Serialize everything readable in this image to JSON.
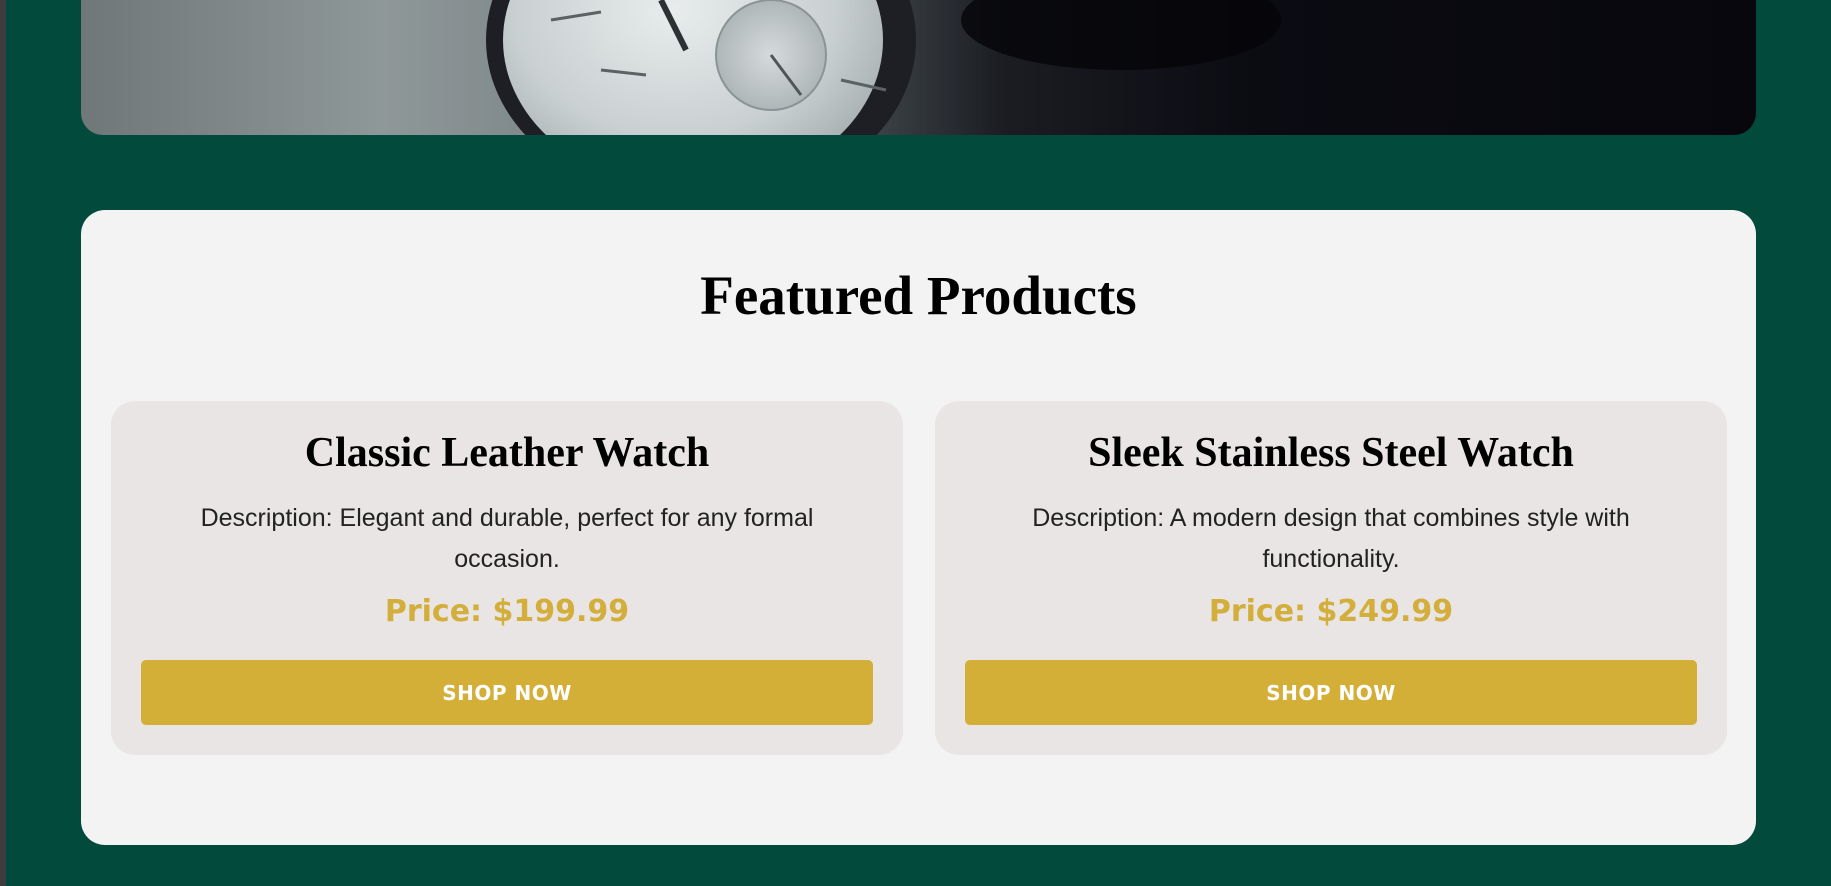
{
  "hero": {
    "image_alt": "watch-photo"
  },
  "featured": {
    "title": "Featured Products",
    "products": [
      {
        "name": "Classic Leather Watch",
        "description": "Description: Elegant and durable, perfect for any formal occasion.",
        "price": "Price: $199.99",
        "button": "SHOP NOW"
      },
      {
        "name": "Sleek Stainless Steel Watch",
        "description": "Description: A modern design that combines style with functionality.",
        "price": "Price: $249.99",
        "button": "SHOP NOW"
      }
    ]
  },
  "colors": {
    "background": "#014a3c",
    "panel": "#f3f3f3",
    "card": "#e8e5e4",
    "accent": "#d4af38",
    "text": "#000000"
  }
}
